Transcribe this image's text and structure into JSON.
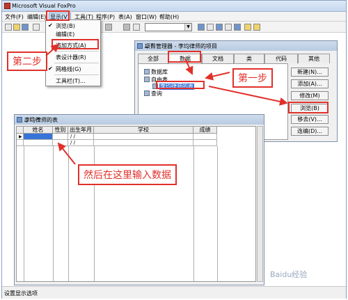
{
  "app": {
    "title": "Microsoft Visual FoxPro"
  },
  "menu": [
    "文件(F)",
    "编辑(E)",
    "显示(V)",
    "工具(T)",
    "程序(P)",
    "表(A)",
    "窗口(W)",
    "帮助(H)"
  ],
  "display_menu": {
    "items": [
      {
        "label": "浏览(B)",
        "checked": true
      },
      {
        "label": "编辑(E)",
        "checked": false
      },
      {
        "label": "追加方式(A)",
        "checked": false
      },
      {
        "label": "表设计器(R)",
        "checked": false
      },
      {
        "label": "网格线(G)",
        "checked": true
      },
      {
        "label": "工具栏(T)...",
        "checked": false
      }
    ]
  },
  "project_manager": {
    "title": "项目管理器 - 李均律师的项目",
    "tabs": [
      "全部",
      "数据",
      "文档",
      "类",
      "代码",
      "其他"
    ],
    "tree": [
      "数据库",
      "自由表",
      "李均律师的表",
      "查询"
    ],
    "buttons": [
      "新建(N)...",
      "添加(A)...",
      "修改(M)",
      "浏览(B)",
      "移去(V)...",
      "连编(D)..."
    ]
  },
  "table_window": {
    "title": "李均律师的表",
    "columns": [
      "姓名",
      "性别",
      "出生年月",
      "学校",
      "成绩"
    ],
    "rows": [
      [
        "",
        "",
        "/ /",
        "",
        ""
      ],
      [
        "",
        "",
        "/ /",
        "",
        ""
      ]
    ]
  },
  "annotations": {
    "step1": "第一步",
    "step2": "第二步",
    "enter_data": "然后在这里输入数据"
  },
  "status": {
    "text": "设置显示选项"
  },
  "watermark": "Baidu经验",
  "colors": {
    "annotation_red": "#e0302a",
    "selection_blue": "#3874d8"
  }
}
